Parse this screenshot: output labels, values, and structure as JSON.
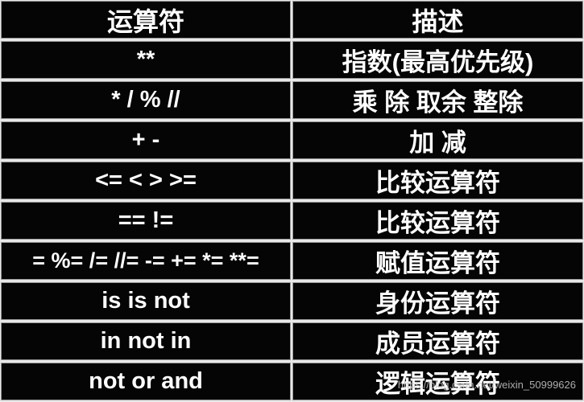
{
  "table": {
    "headers": [
      "运算符",
      "描述"
    ],
    "rows": [
      {
        "operator": "**",
        "description": "指数(最高优先级)"
      },
      {
        "operator": "* / % //",
        "description": "乘 除 取余 整除"
      },
      {
        "operator": "+ -",
        "description": "加 减"
      },
      {
        "operator": "<= < > >=",
        "description": "比较运算符"
      },
      {
        "operator": "== !=",
        "description": "比较运算符"
      },
      {
        "operator": "= %= /= //= -= += *= **=",
        "description": "赋值运算符"
      },
      {
        "operator": "is is not",
        "description": "身份运算符"
      },
      {
        "operator": "in not in",
        "description": "成员运算符"
      },
      {
        "operator": "not or and",
        "description": "逻辑运算符"
      }
    ]
  },
  "watermark": "https://blog.csdn.net/weixin_50999626",
  "colors": {
    "cell_background": "#050505",
    "text": "#ffffff",
    "grid_lines": "#e8e8e8"
  }
}
